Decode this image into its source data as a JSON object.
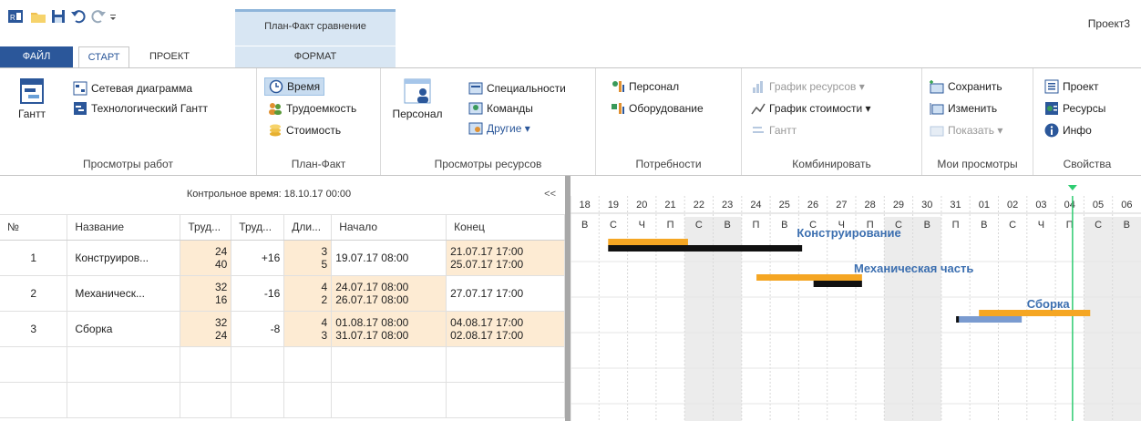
{
  "app": {
    "title": "Проект3"
  },
  "context_tab": {
    "title": "План-Факт сравнение"
  },
  "tabs": {
    "file": "ФАЙЛ",
    "start": "СТАРТ",
    "project": "ПРОЕКТ",
    "format": "ФОРМАТ"
  },
  "ribbon": {
    "views": {
      "label": "Просмотры работ",
      "gantt": "Гантт",
      "network": "Сетевая диаграмма",
      "tech_gantt": "Технологический Гантт"
    },
    "planfact": {
      "label": "План-Факт",
      "time": "Время",
      "labor": "Трудоемкость",
      "cost": "Стоимость"
    },
    "resources": {
      "label": "Просмотры ресурсов",
      "personnel": "Персонал",
      "specialties": "Специальности",
      "teams": "Команды",
      "other": "Другие ▾"
    },
    "needs": {
      "label": "Потребности",
      "personnel": "Персонал",
      "equipment": "Оборудование"
    },
    "combine": {
      "label": "Комбинировать",
      "res_chart": "График ресурсов ▾",
      "cost_chart": "График стоимости ▾",
      "gantt": "Гантт"
    },
    "myviews": {
      "label": "Мои просмотры",
      "save": "Сохранить",
      "edit": "Изменить",
      "show": "Показать ▾"
    },
    "props": {
      "label": "Свойства",
      "project": "Проект",
      "resources": "Ресурсы",
      "info": "Инфо"
    }
  },
  "control_time": "Контрольное время: 18.10.17 00:00",
  "collapse": "<<",
  "columns": [
    "№",
    "Название",
    "Труд...",
    "Труд...",
    "Дли...",
    "Начало",
    "Конец"
  ],
  "rows": [
    {
      "num": "1",
      "name": "Конструиров...",
      "labor_plan": "24",
      "labor_fact": "40",
      "labor_diff": "+16",
      "dur_plan": "3",
      "dur_fact": "5",
      "start_plan": "19.07.17 08:00",
      "start_fact": "",
      "end_plan": "21.07.17 17:00",
      "end_fact": "25.07.17 17:00"
    },
    {
      "num": "2",
      "name": "Механическ...",
      "labor_plan": "32",
      "labor_fact": "16",
      "labor_diff": "-16",
      "dur_plan": "4",
      "dur_fact": "2",
      "start_plan": "24.07.17 08:00",
      "start_fact": "26.07.17 08:00",
      "end_plan": "27.07.17 17:00",
      "end_fact": ""
    },
    {
      "num": "3",
      "name": "Сборка",
      "labor_plan": "32",
      "labor_fact": "24",
      "labor_diff": "-8",
      "dur_plan": "4",
      "dur_fact": "3",
      "start_plan": "01.08.17 08:00",
      "start_fact": "31.07.17 08:00",
      "end_plan": "04.08.17 17:00",
      "end_fact": "02.08.17 17:00"
    }
  ],
  "timeline": {
    "days": [
      "18",
      "19",
      "20",
      "21",
      "22",
      "23",
      "24",
      "25",
      "26",
      "27",
      "28",
      "29",
      "30",
      "31",
      "01",
      "02",
      "03",
      "04",
      "05",
      "06"
    ],
    "weekdays": [
      "В",
      "С",
      "Ч",
      "П",
      "С",
      "В",
      "П",
      "В",
      "С",
      "Ч",
      "П",
      "С",
      "В",
      "П",
      "В",
      "С",
      "Ч",
      "П",
      "С",
      "В"
    ],
    "weekend_index": [
      4,
      5,
      11,
      12,
      18,
      19
    ],
    "bars": [
      {
        "task": "Конструирование",
        "plan_start": 1,
        "plan_end": 3.8,
        "fact_start": 1,
        "fact_end": 7.8,
        "label_pos": 8
      },
      {
        "task": "Механическая часть",
        "plan_start": 6.2,
        "plan_end": 9.9,
        "fact_start": 8.2,
        "fact_end": 9.9,
        "label_pos": 10
      },
      {
        "task": "Сборка",
        "plan_start": 14,
        "plan_end": 17.9,
        "fact_start": 13.2,
        "fact_end": 15.5,
        "label_pos": 16
      }
    ],
    "today_index": 17.6
  },
  "colors": {
    "plan": "#f5a623",
    "fact": "#111111",
    "fact_alt": "#7a9bd0",
    "today": "#2ecc71",
    "accent": "#2b579a"
  }
}
